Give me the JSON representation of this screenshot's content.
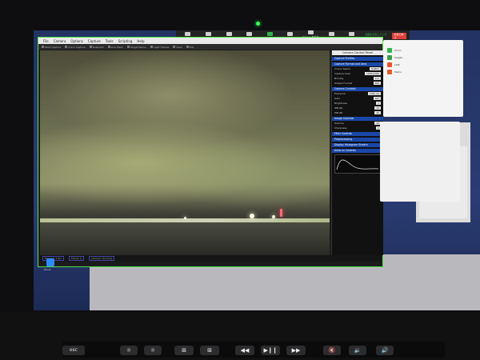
{
  "zoom_bar": {
    "buttons": [
      {
        "label": "ミュート",
        "icon": "microphone-icon"
      },
      {
        "label": "ビデオの停止",
        "icon": "video-camera-icon"
      },
      {
        "label": "セキュリティ",
        "icon": "shield-icon"
      },
      {
        "label": "参加者",
        "icon": "people-icon"
      },
      {
        "label": "新しい共有",
        "icon": "share-screen-icon",
        "accent": "#2fb34a"
      },
      {
        "label": "共有の一時停止",
        "icon": "pause-icon"
      },
      {
        "label": "コメントを付ける",
        "icon": "pencil-icon"
      },
      {
        "label": "リモート制御",
        "icon": "remote-control-icon"
      },
      {
        "label": "詳細",
        "icon": "more-icon"
      }
    ],
    "sharing_status": "画面を共有しています",
    "stop_label": "共有の停止",
    "stop_color": "#e0413a"
  },
  "app": {
    "menu": [
      "File",
      "Camera",
      "Options",
      "Capture",
      "Tools",
      "Scripting",
      "Help"
    ],
    "toolbar": [
      "Start Capture",
      "Quick Capture",
      "Snapshot",
      "Live Stack",
      "Target Name:",
      "Light Frames",
      "Dark",
      "Flat"
    ],
    "control_title": "Camera Control Panel",
    "sections": [
      {
        "title": "Capture Profiles",
        "rows": []
      },
      {
        "title": "Capture Format and Area",
        "rows": [
          {
            "label": "Colour Space",
            "value": "RGB24"
          },
          {
            "label": "Capture Area",
            "value": "1936x1096"
          },
          {
            "label": "Binning",
            "value": "1x1"
          },
          {
            "label": "Output Format",
            "value": "SER"
          }
        ]
      },
      {
        "title": "Camera Controls",
        "rows": [
          {
            "label": "Exposure",
            "value": "1000 ms"
          },
          {
            "label": "Gain",
            "value": "300"
          },
          {
            "label": "Brightness",
            "value": "1"
          },
          {
            "label": "WB (R)",
            "value": "52"
          },
          {
            "label": "WB (B)",
            "value": "95"
          }
        ]
      },
      {
        "title": "Image Controls",
        "rows": [
          {
            "label": "Gamma",
            "value": "50"
          },
          {
            "label": "Sharpness",
            "value": "0"
          }
        ]
      },
      {
        "title": "Filter Controls",
        "rows": []
      },
      {
        "title": "Preprocessing",
        "rows": []
      },
      {
        "title": "Display Histogram Stretch",
        "rows": []
      },
      {
        "title": "Autorun Controls",
        "rows": []
      }
    ],
    "status": [
      "Preview: 1 fps",
      "Frame: 0",
      "Camera: Running"
    ]
  },
  "chat_list": {
    "items": [
      {
        "label": "Zoom",
        "color": "#2fb34a"
      },
      {
        "label": "Kaggle",
        "color": "#3aa14a"
      },
      {
        "label": "LINE",
        "color": "#e8532b"
      },
      {
        "label": "Memo",
        "color": "#e55a2a"
      }
    ]
  },
  "desktop": {
    "zoom_label": "Zoom"
  },
  "touch_bar": {
    "esc_label": "esc",
    "keys": [
      "☼",
      "☼",
      "⊞",
      "⊞",
      "◀◀",
      "▶❙❙",
      "▶▶",
      "🔇",
      "🔉",
      "🔊"
    ]
  }
}
